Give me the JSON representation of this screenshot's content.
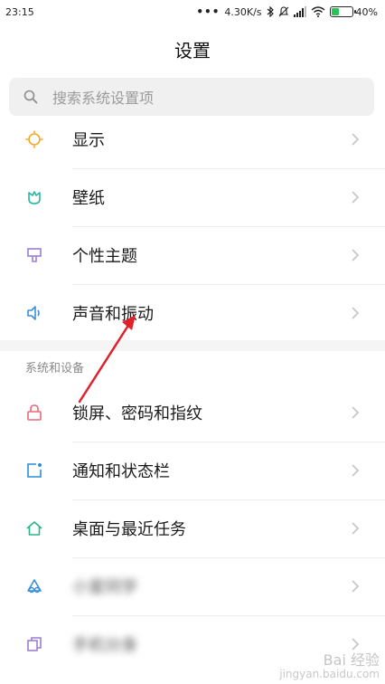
{
  "status_bar": {
    "time": "23:15",
    "speed": "4.30K/s",
    "battery_percent": "40%",
    "battery_level": 0.4,
    "battery_color": "#2ec15a"
  },
  "header": {
    "title": "设置"
  },
  "search": {
    "placeholder": "搜索系统设置项"
  },
  "groups": {
    "personal": [
      {
        "label": "显示",
        "icon": "brightness-icon",
        "color": "#f5a623"
      },
      {
        "label": "壁纸",
        "icon": "wallpaper-icon",
        "color": "#2bb5a0"
      },
      {
        "label": "个性主题",
        "icon": "theme-icon",
        "color": "#9b7fd4"
      },
      {
        "label": "声音和振动",
        "icon": "speaker-icon",
        "color": "#3a8fd8"
      }
    ],
    "system_header": "系统和设备",
    "system": [
      {
        "label": "锁屏、密码和指纹",
        "icon": "lock-icon",
        "color": "#e86a7a"
      },
      {
        "label": "通知和状态栏",
        "icon": "notification-icon",
        "color": "#2a8fd6"
      },
      {
        "label": "桌面与最近任务",
        "icon": "home-icon",
        "color": "#2bb58a"
      },
      {
        "label": "小爱同学",
        "icon": "assistant-icon",
        "color": "#3a8fd8",
        "blurred": true
      },
      {
        "label": "手机分身",
        "icon": "second-space-icon",
        "color": "#9b7fd4",
        "blurred": true
      }
    ]
  },
  "watermark": {
    "line1": "Bai 经验",
    "line2": "jingyan.baidu.com"
  },
  "annotation": {
    "arrow_color": "#e0202a"
  }
}
